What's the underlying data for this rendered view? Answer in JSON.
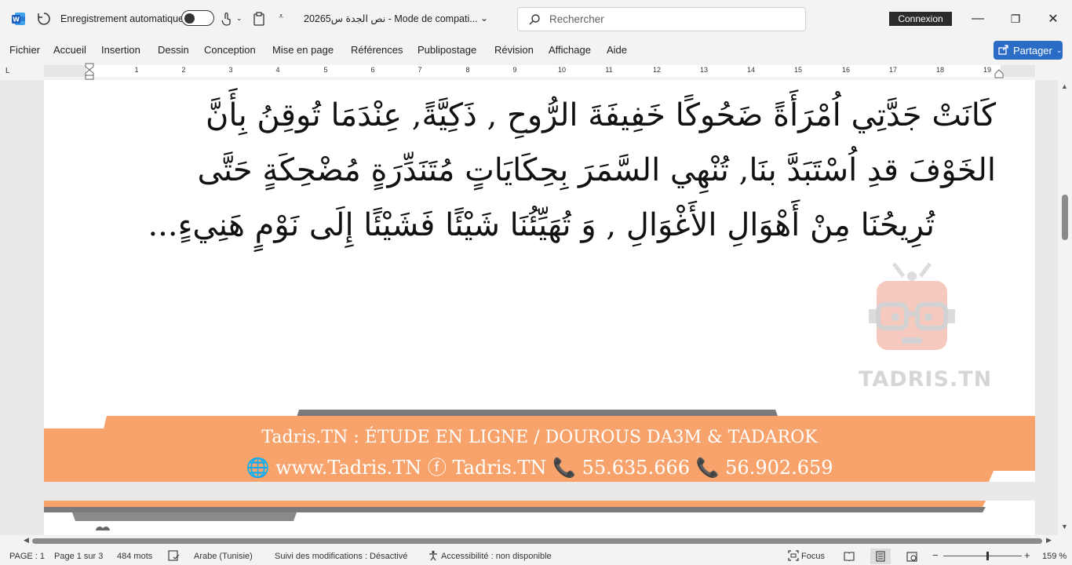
{
  "titlebar": {
    "autosave_label": "Enregistrement automatique",
    "autosave_state": "off",
    "doc_title": "نص الجدة س20265  -  Mode de compati...",
    "search_placeholder": "Rechercher",
    "connexion_label": "Connexion",
    "minimize_glyph": "—",
    "restore_glyph": "❐",
    "close_glyph": "✕"
  },
  "menu": {
    "items": [
      "Fichier",
      "Accueil",
      "Insertion",
      "Dessin",
      "Conception",
      "Mise en page",
      "Références",
      "Publipostage",
      "Révision",
      "Affichage",
      "Aide"
    ],
    "share_label": "Partager"
  },
  "ruler": {
    "corner": "L",
    "numbers": [
      "1",
      "2",
      "3",
      "4",
      "5",
      "6",
      "7",
      "8",
      "9",
      "10",
      "11",
      "12",
      "13",
      "14",
      "15",
      "16",
      "17",
      "18",
      "19"
    ]
  },
  "document": {
    "lines": [
      "كَانَتْ جَدَّتِي اُمْرَأَةً ضَحُوكًا خَفِيفَةَ الرُّوحِ , ذَكِيَّةً, عِنْدَمَا تُوقِنُ بِأَنَّ",
      "الخَوْفَ قدِ اُسْتَبَدَّ بنَا, تُنْهِي السَّمَرَ بِحِكَايَاتٍ  مُتَنَدِّرَةٍ  مُضْحِكَةٍ حَتَّى",
      "تُرِيحُنَا مِنْ أَهْوَالِ الأَغْوَالِ , وَ تُهَيِّئُنَا شَيْئًا فَشَيْئًا إِلَى نَوْمٍ هَنِيءٍ..."
    ],
    "watermark_text": "TADRIS.TN",
    "footer_line1": "Tadris.TN : ÉTUDE EN LIGNE / DOUROUS DA3M & TADAROK",
    "footer_line2": "🌐 www.Tadris.TN    ⓕ  Tadris.TN   📞 55.635.666 📞 56.902.659",
    "accent_orange": "#f8a36c"
  },
  "status": {
    "page": "PAGE : 1",
    "page_of": "Page 1 sur 3",
    "words": "484 mots",
    "language": "Arabe (Tunisie)",
    "track_changes": "Suivi des modifications : Désactivé",
    "accessibility": "Accessibilité : non disponible",
    "focus": "Focus",
    "zoom": "159 %",
    "zoom_minus": "−",
    "zoom_plus": "+"
  }
}
